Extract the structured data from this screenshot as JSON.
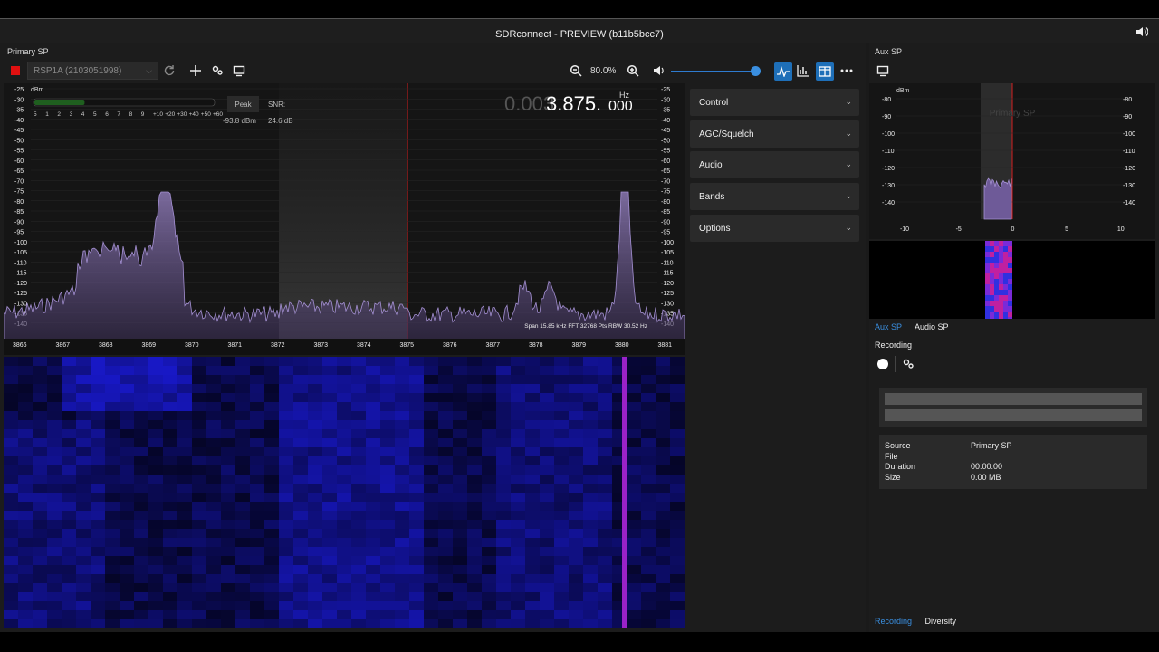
{
  "window": {
    "title": "SDRconnect - PREVIEW (b11b5bcc7)"
  },
  "primary": {
    "label": "Primary SP",
    "device": "RSP1A (2103051998)",
    "zoom": "80.0%",
    "volume_level": 0.95,
    "frequency": {
      "dim": "0.003",
      "main": "3.875.",
      "small": "000",
      "unit": "Hz"
    },
    "meter": {
      "unit": "dBm",
      "scale": [
        "5",
        "1",
        "2",
        "3",
        "4",
        "5",
        "6",
        "7",
        "8",
        "9",
        "+10",
        "+20",
        "+30",
        "+40",
        "+50",
        "+60"
      ],
      "peak_label": "Peak",
      "peak_value": "-93.8 dBm",
      "snr_label": "SNR:",
      "snr_value": "24.6 dB",
      "level": 0.28
    },
    "y_ticks": [
      "-25",
      "-30",
      "-35",
      "-40",
      "-45",
      "-50",
      "-55",
      "-60",
      "-65",
      "-70",
      "-75",
      "-80",
      "-85",
      "-90",
      "-95",
      "-100",
      "-105",
      "-110",
      "-115",
      "-120",
      "-125",
      "-130",
      "-135",
      "-140"
    ],
    "x_ticks": [
      "3866",
      "3867",
      "3868",
      "3869",
      "3870",
      "3871",
      "3872",
      "3873",
      "3874",
      "3875",
      "3876",
      "3877",
      "3878",
      "3879",
      "3880",
      "3881"
    ],
    "info_line": "Span 15.85 kHz FFT 32768 Pts  RBW 30.52 Hz",
    "accordion": [
      "Control",
      "AGC/Squelch",
      "Audio",
      "Bands",
      "Options"
    ]
  },
  "aux": {
    "label": "Aux SP",
    "unit": "dBm",
    "overlay": "Primary SP",
    "y_ticks": [
      "-80",
      "-90",
      "-100",
      "-110",
      "-120",
      "-130",
      "-140"
    ],
    "x_ticks": [
      "-10",
      "-5",
      "0",
      "5",
      "10"
    ],
    "tabs": [
      "Aux SP",
      "Audio SP"
    ],
    "recording": {
      "title": "Recording",
      "fields": [
        {
          "key": "Source",
          "value": "Primary SP"
        },
        {
          "key": "File",
          "value": ""
        },
        {
          "key": "Duration",
          "value": "00:00:00"
        },
        {
          "key": "Size",
          "value": "0.00 MB"
        }
      ]
    },
    "bottom_tabs": [
      "Recording",
      "Diversity"
    ]
  },
  "colors": {
    "accent": "#1e6fb8",
    "trace": "#9b85c8",
    "marker": "#d42020",
    "waterfall": "#1a1ad0"
  }
}
